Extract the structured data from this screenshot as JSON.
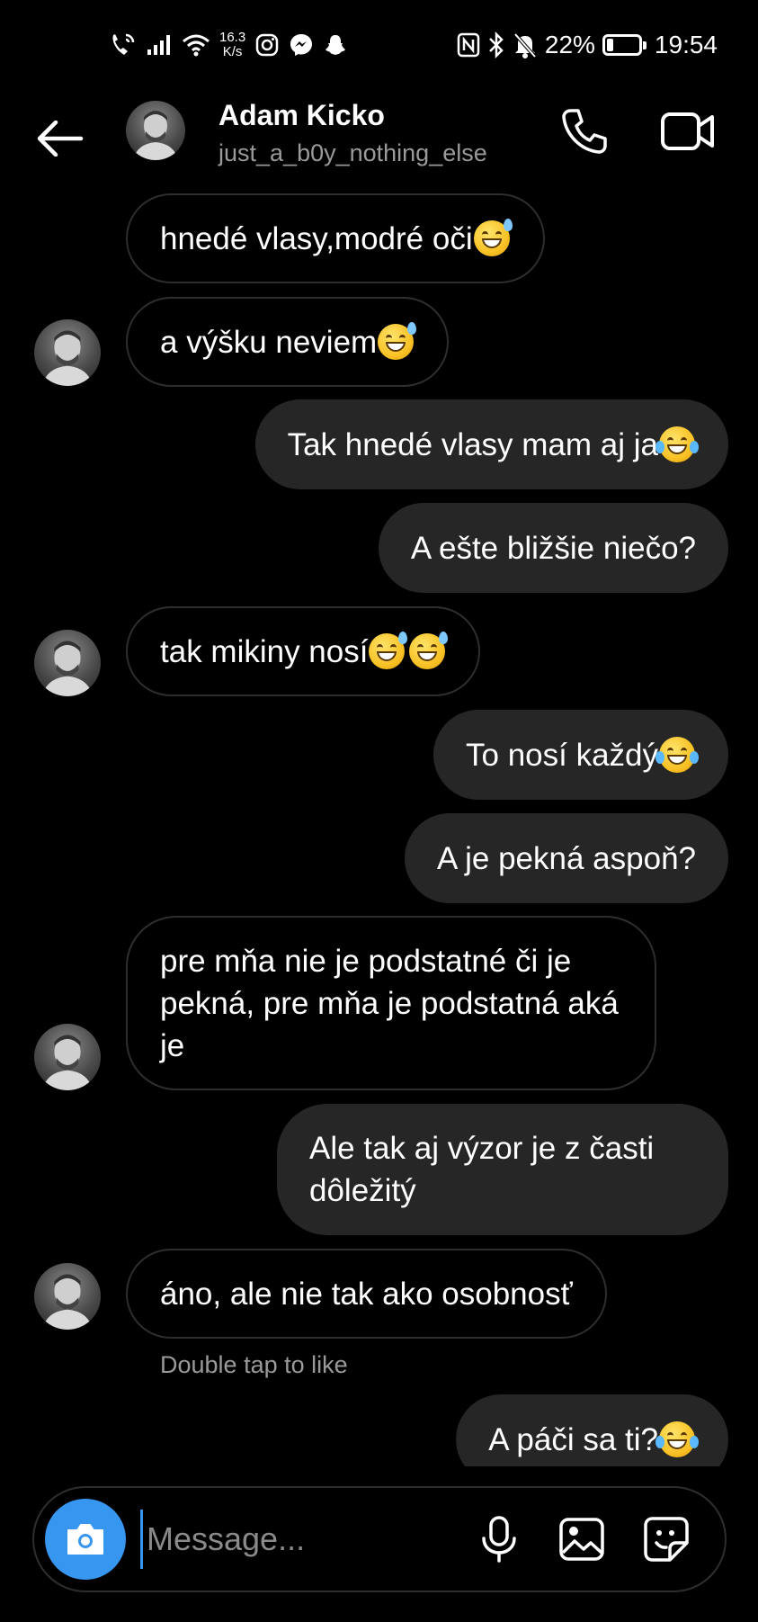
{
  "status_bar": {
    "net_speed_value": "16.3",
    "net_speed_unit": "K/s",
    "battery": "22%",
    "battery_level": 0.22,
    "time": "19:54"
  },
  "header": {
    "name": "Adam Kicko",
    "username": "just_a_b0y_nothing_else"
  },
  "messages": [
    {
      "dir": "in",
      "text": "hnedé vlasy,modré oči",
      "emoji": [
        "sweat"
      ]
    },
    {
      "dir": "in",
      "text": "a výšku neviem",
      "emoji": [
        "sweat"
      ]
    },
    {
      "dir": "out",
      "text": "Tak hnedé vlasy mam aj ja ",
      "emoji": [
        "tears"
      ]
    },
    {
      "dir": "out",
      "text": "A ešte bližšie niečo?",
      "emoji": []
    },
    {
      "dir": "in",
      "text": "tak mikiny nosí",
      "emoji": [
        "sweat",
        "sweat"
      ]
    },
    {
      "dir": "out",
      "text": "To nosí každý ",
      "emoji": [
        "tears"
      ]
    },
    {
      "dir": "out",
      "text": "A je pekná aspoň?",
      "emoji": []
    },
    {
      "dir": "in",
      "text": "pre mňa nie je podstatné či je pekná, pre mňa je podstatná aká je",
      "emoji": []
    },
    {
      "dir": "out",
      "text": "Ale tak aj výzor je z časti dôležitý",
      "emoji": []
    },
    {
      "dir": "in",
      "text": "áno, ale nie tak ako osobnosť",
      "emoji": []
    },
    {
      "dir": "out",
      "text": "A páči sa ti? ",
      "emoji": [
        "tears"
      ]
    }
  ],
  "hint": "Double tap to like",
  "composer": {
    "placeholder": "Message..."
  },
  "icons": {
    "back": "arrow-left-icon",
    "call": "phone-icon",
    "video": "video-camera-icon",
    "camera": "camera-icon",
    "mic": "microphone-icon",
    "gallery": "image-icon",
    "sticker": "sticker-icon"
  },
  "colors": {
    "background": "#000000",
    "outgoing_bubble": "#262626",
    "incoming_border": "#2e2e2e",
    "accent": "#3797f0",
    "secondary_text": "#9a9a9a"
  }
}
